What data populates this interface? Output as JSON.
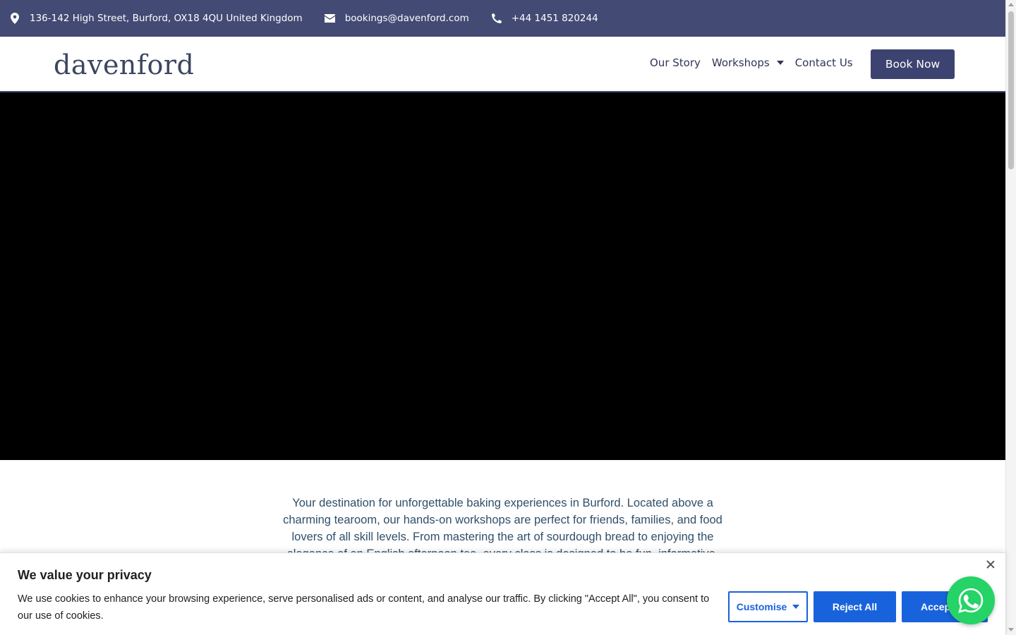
{
  "topbar": {
    "address": "136-142 High Street, Burford, OX18 4QU United Kingdom",
    "email": "bookings@davenford.com",
    "phone": "+44 1451 820244",
    "color": "#434a73"
  },
  "header": {
    "logo_text": "davenford",
    "nav": [
      {
        "label": "Our Story"
      },
      {
        "label": "Workshops"
      },
      {
        "label": "Contact Us"
      }
    ],
    "book_label": "Book Now"
  },
  "intro": {
    "text": "Your destination for unforgettable baking experiences in Burford. Located above a charming tearoom, our hands-on workshops are perfect for friends, families, and food lovers of all skill levels. From mastering the art of sourdough bread to enjoying the elegance of an English afternoon tea, every class is designed to be fun, informative, and"
  },
  "cookie": {
    "title": "We value your privacy",
    "description": "We use cookies to enhance your browsing experience, serve personalised ads or content, and analyse our traffic. By clicking \"Accept All\", you consent to our use of cookies.",
    "customise_label": "Customise",
    "reject_label": "Reject All",
    "accept_label": "Accept All",
    "accent": "#1863dc"
  },
  "icons": {
    "address": "map-pin-icon",
    "email": "envelope-icon",
    "phone": "phone-icon",
    "chat": "whatsapp-icon"
  }
}
